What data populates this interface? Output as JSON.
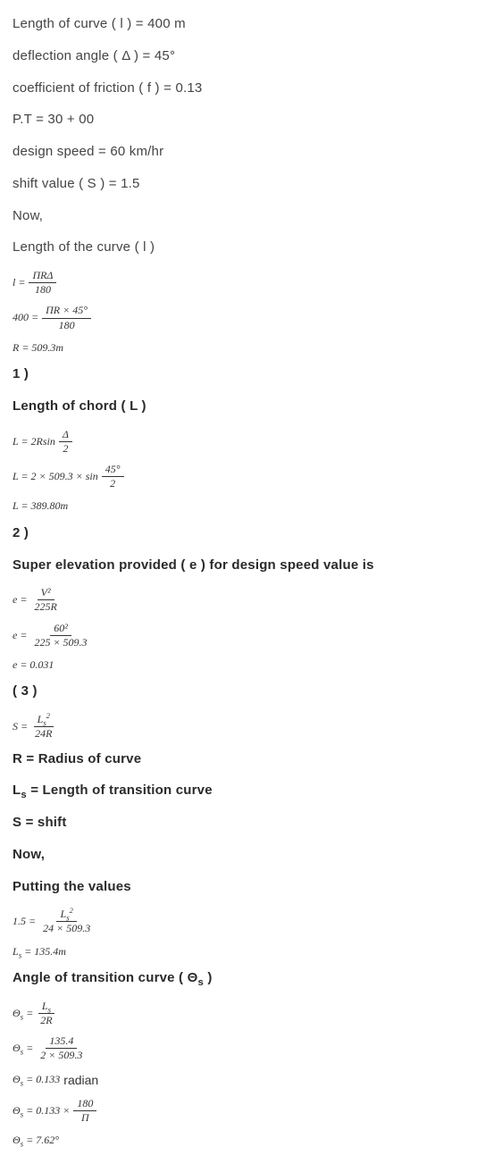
{
  "given": [
    "Length of curve ( l ) = 400 m",
    "deflection angle ( Δ ) = 45°",
    "coefficient of friction ( f ) = 0.13",
    "P.T = 30 + 00",
    "design speed = 60 km/hr",
    "shift value ( S ) = 1.5",
    "Now,",
    "Length of the curve ( l )"
  ],
  "eq_l": {
    "lhs": "l =",
    "num": "ΠRΔ",
    "den": "180"
  },
  "eq_l2": {
    "lhs": "400 =",
    "num": "ΠR × 45°",
    "den": "180"
  },
  "eq_R": "R = 509.3m",
  "sec1": "1 )",
  "sec1_title": "Length of chord ( L )",
  "eq_L_formula": {
    "lhs": "L = 2Rsin",
    "num": "Δ",
    "den": "2"
  },
  "eq_L_calc": {
    "lhs": "L = 2 × 509.3 × sin",
    "num": "45°",
    "den": "2"
  },
  "eq_L_res": "L = 389.80m",
  "sec2": "2 )",
  "sec2_title": "Super elevation provided ( e ) for design speed value is",
  "eq_e1": {
    "lhs": "e =",
    "num": "V²",
    "den": "225R"
  },
  "eq_e2": {
    "lhs": "e =",
    "num": "60²",
    "den": "225 × 509.3"
  },
  "eq_e3": "e = 0.031",
  "sec3": "( 3 )",
  "eq_S": {
    "lhs": "S =",
    "num_base": "L",
    "num_sub": "s",
    "num_sup": "2",
    "den": "24R"
  },
  "defs": [
    "R = Radius of curve",
    "Ls_def",
    "S = shift",
    "Now,",
    "Putting the values"
  ],
  "ls_def_text": "L",
  "ls_def_sub": "s",
  "ls_def_rest": " = Length of transition curve",
  "shift_def": "S = shift",
  "now2": "Now,",
  "putting": "Putting the values",
  "eq_15": {
    "lhs": "1.5 =",
    "num_base": "L",
    "num_sub": "s",
    "num_sup": "2",
    "den": "24 × 509.3"
  },
  "eq_Ls_res": {
    "pre": "L",
    "sub": "s",
    "rest": " = 135.4m"
  },
  "sec_theta_title_pre": "Angle of transition curve ( Θ",
  "sec_theta_title_sub": "s",
  "sec_theta_title_post": " )",
  "eq_th1": {
    "lhs_pre": "Θ",
    "lhs_sub": "s",
    "lhs_post": " =",
    "num_base": "L",
    "num_sub": "s",
    "den": "2R"
  },
  "eq_th2": {
    "lhs_pre": "Θ",
    "lhs_sub": "s",
    "lhs_post": " =",
    "num": "135.4",
    "den": "2 × 509.3"
  },
  "eq_th3": {
    "lhs_pre": "Θ",
    "lhs_sub": "s",
    "rest": " = 0.133",
    "word": " radian"
  },
  "eq_th4": {
    "lhs_pre": "Θ",
    "lhs_sub": "s",
    "mid": " = 0.133 ×",
    "num": "180",
    "den": "Π"
  },
  "eq_th5": {
    "lhs_pre": "Θ",
    "lhs_sub": "s",
    "rest": " = 7.62°"
  }
}
